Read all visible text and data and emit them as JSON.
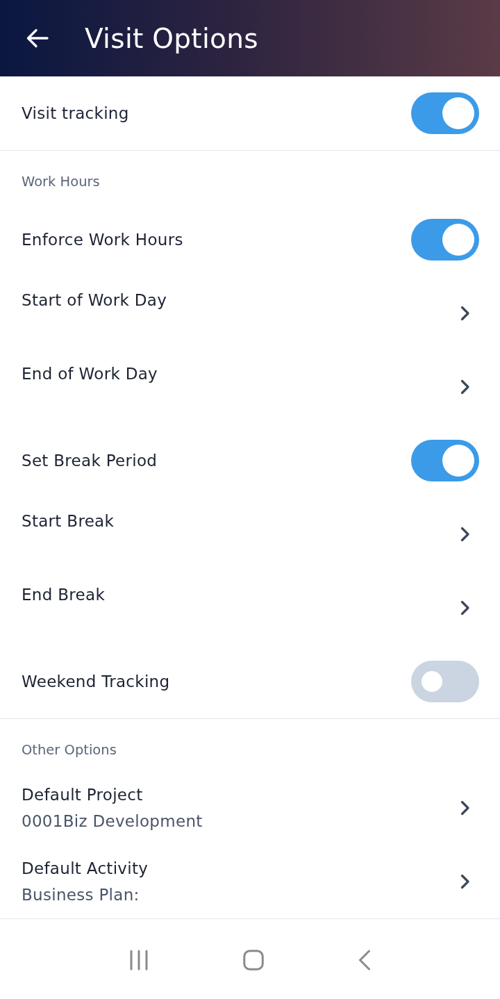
{
  "header": {
    "title": "Visit Options"
  },
  "sections": [
    {
      "rows": [
        {
          "kind": "toggle",
          "label": "Visit tracking",
          "on": true
        }
      ]
    },
    {
      "title": "Work Hours",
      "rows": [
        {
          "kind": "toggle",
          "label": "Enforce Work Hours",
          "on": true
        },
        {
          "kind": "link",
          "label": "Start of Work Day"
        },
        {
          "kind": "link",
          "label": "End of Work Day"
        },
        {
          "kind": "toggle",
          "label": "Set Break Period",
          "on": true
        },
        {
          "kind": "link",
          "label": "Start Break"
        },
        {
          "kind": "link",
          "label": "End Break"
        },
        {
          "kind": "toggle",
          "label": "Weekend Tracking",
          "on": false
        }
      ]
    },
    {
      "title": "Other Options",
      "rows": [
        {
          "kind": "link",
          "label": "Default Project",
          "value": "0001Biz Development"
        },
        {
          "kind": "link",
          "label": "Default Activity",
          "value": "Business Plan:"
        }
      ]
    }
  ]
}
